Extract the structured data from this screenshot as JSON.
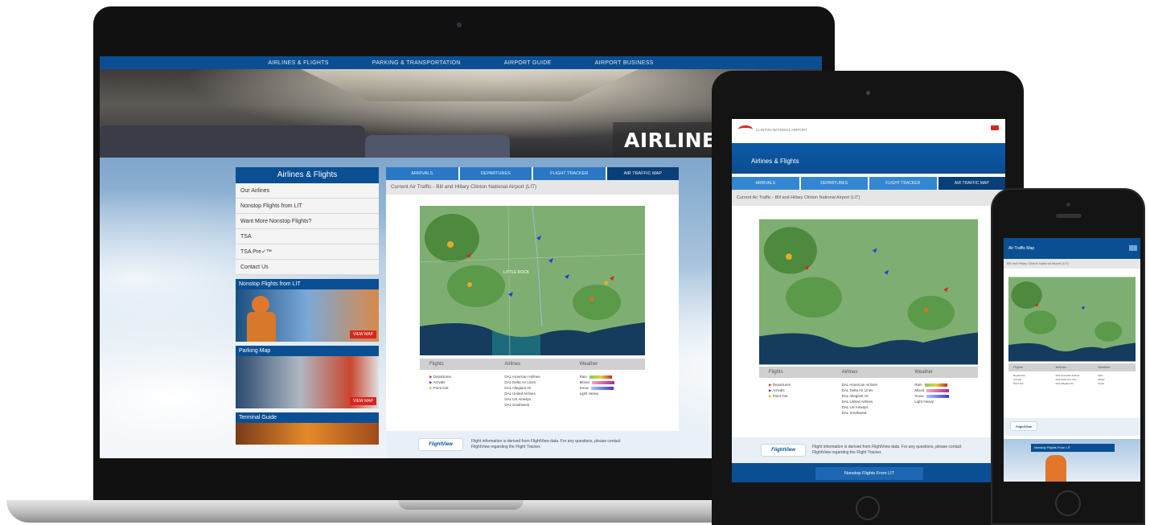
{
  "laptop": {
    "topnav": [
      "AIRLINES & FLIGHTS",
      "PARKING & TRANSPORTATION",
      "AIRPORT GUIDE",
      "AIRPORT BUSINESS"
    ],
    "hero_title": "AIRLINES & FLIGHTS",
    "sidebar": {
      "title": "Airlines & Flights",
      "items": [
        "Our Airlines",
        "Nonstop Flights from LIT",
        "Want More Nonstop Flights?",
        "TSA",
        "TSA Pre✓™",
        "Contact Us"
      ]
    },
    "promos": [
      {
        "title": "Nonstop Flights from LIT",
        "button": "VIEW MAP"
      },
      {
        "title": "Parking Map",
        "button": "VIEW MAP"
      },
      {
        "title": "Terminal Guide",
        "button": ""
      }
    ],
    "tabs": [
      "ARRIVALS",
      "DEPARTURES",
      "FLIGHT TRACKER",
      "AIR TRAFFIC MAP"
    ],
    "active_tab": "AIR TRAFFIC MAP",
    "panel_caption": "Current Air Traffic - Bill and Hillary Clinton National Airport (LIT)",
    "map_city_label": "LITTLE ROCK",
    "legend": {
      "headers": [
        "Flights",
        "Airlines",
        "Weather"
      ],
      "flights": [
        "Departures",
        "Arrivals",
        "Point Out"
      ],
      "airlines": [
        "DAL  American Airlines",
        "DAL  Delta Air Lines",
        "DAL  Allegiant Air",
        "DAL  United Airlines",
        "DAL  US Airways",
        "DAL  Southwest"
      ],
      "weather": [
        "Rain",
        "Mixed",
        "Snow",
        "Light    Heavy"
      ]
    },
    "flightview": {
      "logo": "FlightView",
      "text": "Flight information is derived from FlightView data. For any questions, please contact FlightView regarding the Flight Tracker."
    }
  },
  "tablet": {
    "logo_text": "CLINTON NATIONAL AIRPORT",
    "band_title": "Airlines & Flights",
    "tabs": [
      "ARRIVALS",
      "DEPARTURES",
      "FLIGHT TRACKER",
      "AIR TRAFFIC MAP"
    ],
    "caption": "Current Air Traffic - Bill and Hillary Clinton National Airport (LIT)",
    "nonstop_button": "Nonstop Flights From LIT"
  },
  "phone": {
    "header_title": "Air Traffic Map",
    "subtitle": "Bill and Hillary Clinton National Airport (LIT)",
    "promo_title": "Nonstop Flights From LIT"
  },
  "colors": {
    "brand_blue": "#0a4f93",
    "tab_blue": "#2a78c4",
    "active_tab": "#0a3e76",
    "accent_red": "#d6261f"
  }
}
